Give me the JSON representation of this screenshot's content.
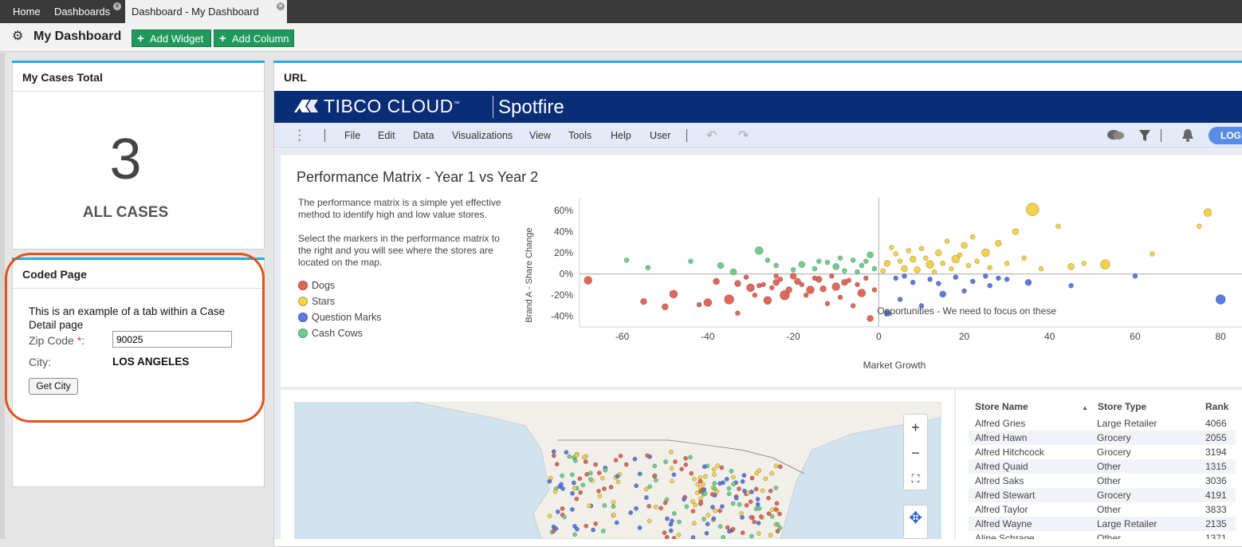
{
  "tabs": [
    {
      "label": "Home",
      "closable": false,
      "active": false
    },
    {
      "label": "Dashboards",
      "closable": true,
      "active": false
    },
    {
      "label": "Dashboard - My Dashboard",
      "closable": true,
      "active": true
    }
  ],
  "toolbar": {
    "title": "My Dashboard",
    "add_widget": "Add Widget",
    "add_column": "Add Column"
  },
  "cases_panel": {
    "title": "My Cases Total",
    "count": "3",
    "label": "ALL CASES"
  },
  "coded_panel": {
    "title": "Coded Page",
    "text": "This is an example of a tab within a Case Detail page",
    "zip_label": "Zip Code",
    "zip_required": "*",
    "zip_colon": ":",
    "zip_value": "90025",
    "city_label": "City:",
    "city_value": "LOS ANGELES",
    "button": "Get City"
  },
  "url_panel": {
    "title": "URL"
  },
  "spotfire": {
    "brand": "TIBCO CLOUD",
    "tm": "™",
    "product": "Spotfire",
    "menu": [
      "File",
      "Edit",
      "Data",
      "Visualizations",
      "View",
      "Tools",
      "Help",
      "User"
    ],
    "login": "LOG"
  },
  "performance": {
    "title": "Performance Matrix - Year 1 vs Year 2",
    "desc1": "The performance matrix is a simple yet effective method to identify high and low value stores.",
    "desc2": "Select the markers in the performance matrix to the right and you will see where the stores are located on the map.",
    "legend": [
      {
        "label": "Dogs",
        "color": "#e0685a"
      },
      {
        "label": "Stars",
        "color": "#f2d14b"
      },
      {
        "label": "Question Marks",
        "color": "#5a7be0"
      },
      {
        "label": "Cash Cows",
        "color": "#6ecf8a"
      }
    ],
    "annotation": "Opportunities - We need to focus on these"
  },
  "chart_data": {
    "type": "scatter",
    "xlabel": "Market Growth",
    "ylabel": "Brand A - Share Change",
    "x_ticks": [
      "-60",
      "-40",
      "-20",
      "0",
      "20",
      "40",
      "60",
      "80"
    ],
    "y_ticks": [
      "60%",
      "40%",
      "20%",
      "0%",
      "-20%",
      "-40%"
    ],
    "xlim": [
      -70,
      85
    ],
    "ylim": [
      -0.5,
      0.72
    ],
    "series": [
      {
        "name": "Dogs",
        "color": "#e0685a",
        "points": [
          [
            -68,
            -0.06,
            5
          ],
          [
            -55,
            -0.26,
            4
          ],
          [
            -50,
            -0.31,
            4
          ],
          [
            -48,
            -0.19,
            5
          ],
          [
            -42,
            -0.29,
            3
          ],
          [
            -40,
            -0.27,
            5
          ],
          [
            -38,
            -0.07,
            4
          ],
          [
            -35,
            -0.24,
            6
          ],
          [
            -33,
            -0.37,
            3
          ],
          [
            -30,
            -0.13,
            5
          ],
          [
            -28,
            -0.11,
            3
          ],
          [
            -26,
            -0.25,
            5
          ],
          [
            -24,
            -0.08,
            4
          ],
          [
            -22,
            -0.2,
            6
          ],
          [
            -20,
            -0.02,
            4
          ],
          [
            -18,
            -0.1,
            3
          ],
          [
            -16,
            -0.15,
            5
          ],
          [
            -14,
            -0.05,
            4
          ],
          [
            -12,
            -0.28,
            3
          ],
          [
            -10,
            -0.12,
            5
          ],
          [
            -8,
            -0.08,
            4
          ],
          [
            -6,
            -0.3,
            3
          ],
          [
            -4,
            -0.18,
            5
          ],
          [
            -3,
            -0.04,
            3
          ],
          [
            -2,
            -0.42,
            4
          ],
          [
            -1,
            -0.15,
            3
          ],
          [
            -24,
            -0.02,
            3
          ],
          [
            -19,
            -0.07,
            4
          ],
          [
            -17,
            -0.2,
            3
          ],
          [
            -15,
            -0.04,
            3
          ],
          [
            -13,
            -0.14,
            4
          ],
          [
            -11,
            -0.02,
            3
          ],
          [
            -9,
            -0.22,
            3
          ],
          [
            -7,
            -0.06,
            3
          ],
          [
            -5,
            -0.1,
            3
          ],
          [
            -27,
            -0.1,
            3
          ],
          [
            -33,
            -0.09,
            4
          ],
          [
            -21,
            -0.15,
            4
          ],
          [
            -23,
            -0.05,
            3
          ],
          [
            -25,
            -0.13,
            3
          ],
          [
            -29,
            -0.2,
            3
          ],
          [
            -31,
            -0.03,
            3
          ]
        ]
      },
      {
        "name": "Stars",
        "color": "#f2d14b",
        "points": [
          [
            36,
            0.61,
            8
          ],
          [
            77,
            0.58,
            5
          ],
          [
            75,
            0.45,
            3
          ],
          [
            53,
            0.09,
            6
          ],
          [
            64,
            0.19,
            3
          ],
          [
            48,
            0.1,
            3
          ],
          [
            42,
            0.45,
            3
          ],
          [
            32,
            0.4,
            4
          ],
          [
            28,
            0.29,
            4
          ],
          [
            25,
            0.2,
            5
          ],
          [
            22,
            0.35,
            3
          ],
          [
            20,
            0.27,
            4
          ],
          [
            18,
            0.14,
            5
          ],
          [
            16,
            0.31,
            3
          ],
          [
            14,
            0.2,
            4
          ],
          [
            12,
            0.09,
            5
          ],
          [
            10,
            0.24,
            3
          ],
          [
            8,
            0.14,
            4
          ],
          [
            6,
            0.05,
            4
          ],
          [
            4,
            0.19,
            3
          ],
          [
            2,
            0.1,
            4
          ],
          [
            1,
            0.03,
            3
          ],
          [
            3,
            0.25,
            3
          ],
          [
            5,
            0.12,
            3
          ],
          [
            7,
            0.22,
            3
          ],
          [
            9,
            0.04,
            4
          ],
          [
            11,
            0.15,
            3
          ],
          [
            13,
            0.02,
            3
          ],
          [
            15,
            0.1,
            3
          ],
          [
            17,
            0.05,
            3
          ],
          [
            19,
            0.18,
            3
          ],
          [
            21,
            0.08,
            3
          ],
          [
            23,
            0.12,
            3
          ],
          [
            26,
            0.06,
            3
          ],
          [
            30,
            0.1,
            3
          ],
          [
            34,
            0.15,
            3
          ],
          [
            38,
            0.05,
            3
          ],
          [
            45,
            0.07,
            4
          ]
        ]
      },
      {
        "name": "Question Marks",
        "color": "#5a7be0",
        "points": [
          [
            80,
            -0.24,
            6
          ],
          [
            60,
            -0.02,
            3
          ],
          [
            45,
            -0.11,
            3
          ],
          [
            35,
            -0.08,
            4
          ],
          [
            30,
            -0.05,
            3
          ],
          [
            25,
            -0.02,
            3
          ],
          [
            20,
            -0.16,
            3
          ],
          [
            15,
            -0.19,
            4
          ],
          [
            10,
            -0.3,
            3
          ],
          [
            5,
            -0.24,
            3
          ],
          [
            2,
            -0.37,
            4
          ],
          [
            8,
            -0.08,
            3
          ],
          [
            12,
            -0.05,
            3
          ],
          [
            18,
            -0.03,
            3
          ],
          [
            22,
            -0.07,
            3
          ],
          [
            26,
            -0.11,
            3
          ],
          [
            4,
            -0.04,
            3
          ],
          [
            6,
            -0.02,
            3
          ],
          [
            14,
            -0.09,
            3
          ],
          [
            28,
            -0.04,
            3
          ]
        ]
      },
      {
        "name": "Cash Cows",
        "color": "#6ecf8a",
        "points": [
          [
            -59,
            0.13,
            3
          ],
          [
            -54,
            0.06,
            3
          ],
          [
            -44,
            0.12,
            3
          ],
          [
            -37,
            0.08,
            4
          ],
          [
            -34,
            0.02,
            4
          ],
          [
            -28,
            0.22,
            5
          ],
          [
            -26,
            0.13,
            3
          ],
          [
            -20,
            0.04,
            3
          ],
          [
            -18,
            0.09,
            4
          ],
          [
            -15,
            0.05,
            3
          ],
          [
            -12,
            0.11,
            3
          ],
          [
            -10,
            0.07,
            4
          ],
          [
            -8,
            0.03,
            3
          ],
          [
            -6,
            0.13,
            3
          ],
          [
            -4,
            0.08,
            3
          ],
          [
            -2,
            0.18,
            4
          ],
          [
            -1,
            0.05,
            3
          ],
          [
            -24,
            0.08,
            3
          ],
          [
            -14,
            0.12,
            3
          ],
          [
            -9,
            0.15,
            3
          ],
          [
            -5,
            0.02,
            3
          ],
          [
            -3,
            0.12,
            3
          ]
        ]
      }
    ]
  },
  "store_table": {
    "headers": [
      "Store Name",
      "Store Type",
      "Rank"
    ],
    "rows": [
      [
        "Alfred Gries",
        "Large Retailer",
        "4066"
      ],
      [
        "Alfred Hawn",
        "Grocery",
        "2055"
      ],
      [
        "Alfred Hitchcock",
        "Grocery",
        "3194"
      ],
      [
        "Alfred Quaid",
        "Other",
        "1315"
      ],
      [
        "Alfred Saks",
        "Other",
        "3036"
      ],
      [
        "Alfred Stewart",
        "Grocery",
        "4191"
      ],
      [
        "Alfred Taylor",
        "Other",
        "3833"
      ],
      [
        "Alfred Wayne",
        "Large Retailer",
        "2135"
      ],
      [
        "Aline Schrage",
        "Other",
        "1371"
      ]
    ]
  }
}
